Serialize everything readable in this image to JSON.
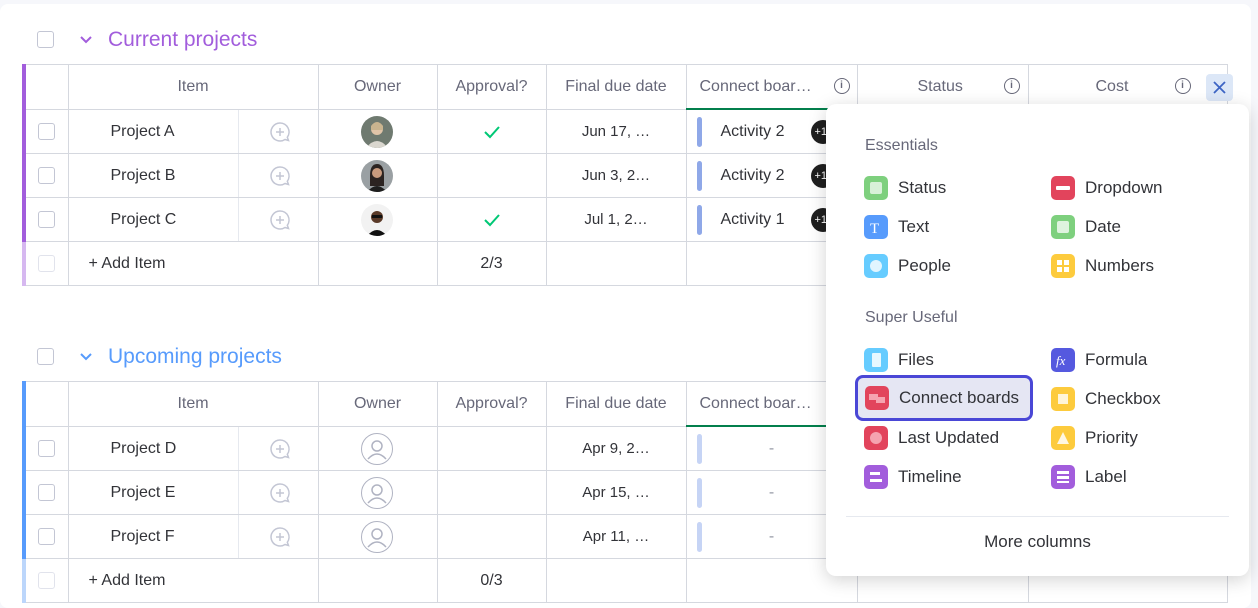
{
  "columns": {
    "item": "Item",
    "owner": "Owner",
    "approval": "Approval?",
    "final_due_date": "Final due date",
    "connect_boards": "Connect boar…",
    "status": "Status",
    "cost": "Cost"
  },
  "groups": [
    {
      "title": "Current projects",
      "color": "#a25ddc",
      "add_item": "+ Add Item",
      "approval_summary": "2/3",
      "rows": [
        {
          "name": "Project A",
          "owner": "photo",
          "approved": true,
          "due": "Jun 17, …",
          "connect": "Activity 2",
          "badge": "+1"
        },
        {
          "name": "Project B",
          "owner": "photo",
          "approved": false,
          "due": "Jun 3, 2…",
          "connect": "Activity 2",
          "badge": "+1"
        },
        {
          "name": "Project C",
          "owner": "photo",
          "approved": true,
          "due": "Jul 1, 2…",
          "connect": "Activity 1",
          "badge": "+1"
        }
      ]
    },
    {
      "title": "Upcoming projects",
      "color": "#579bfc",
      "add_item": "+ Add Item",
      "approval_summary": "0/3",
      "rows": [
        {
          "name": "Project D",
          "owner": "empty",
          "approved": false,
          "due": "Apr 9, 2…",
          "connect": "-"
        },
        {
          "name": "Project E",
          "owner": "empty",
          "approved": false,
          "due": "Apr 15, …",
          "connect": "-"
        },
        {
          "name": "Project F",
          "owner": "empty",
          "approved": false,
          "due": "Apr 11, …",
          "connect": "-"
        }
      ]
    }
  ],
  "column_picker": {
    "essentials_title": "Essentials",
    "essentials": [
      {
        "label": "Status",
        "icon": "status-icon",
        "color": "#7ed07e"
      },
      {
        "label": "Dropdown",
        "icon": "dropdown-icon",
        "color": "#e2445c"
      },
      {
        "label": "Text",
        "icon": "text-icon",
        "color": "#579bfc"
      },
      {
        "label": "Date",
        "icon": "date-icon",
        "color": "#7ed07e"
      },
      {
        "label": "People",
        "icon": "people-icon",
        "color": "#66ccff"
      },
      {
        "label": "Numbers",
        "icon": "numbers-icon",
        "color": "#fdcb3d"
      }
    ],
    "super_useful_title": "Super Useful",
    "super_useful": [
      {
        "label": "Files",
        "icon": "files-icon",
        "color": "#66ccff"
      },
      {
        "label": "Formula",
        "icon": "formula-icon",
        "color": "#5559df"
      },
      {
        "label": "Connect boards",
        "icon": "connect-boards-icon",
        "color": "#e2445c",
        "selected": true
      },
      {
        "label": "Checkbox",
        "icon": "checkbox-icon",
        "color": "#fdcb3d"
      },
      {
        "label": "Last Updated",
        "icon": "last-updated-icon",
        "color": "#e2445c"
      },
      {
        "label": "Priority",
        "icon": "priority-icon",
        "color": "#fdcb3d"
      },
      {
        "label": "Timeline",
        "icon": "timeline-icon",
        "color": "#a25ddc"
      },
      {
        "label": "Label",
        "icon": "label-icon",
        "color": "#a25ddc"
      }
    ],
    "more_columns": "More columns"
  }
}
